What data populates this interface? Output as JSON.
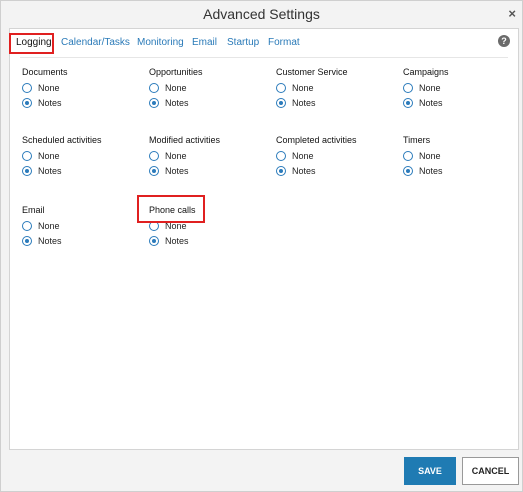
{
  "dialog": {
    "title": "Advanced Settings",
    "close_symbol": "×"
  },
  "tabs": [
    {
      "label": "Logging",
      "active": true
    },
    {
      "label": "Calendar/Tasks",
      "active": false
    },
    {
      "label": "Monitoring",
      "active": false
    },
    {
      "label": "Email",
      "active": false
    },
    {
      "label": "Startup",
      "active": false
    },
    {
      "label": "Format",
      "active": false
    }
  ],
  "help_symbol": "?",
  "groups": [
    {
      "label": "Documents",
      "options": [
        "None",
        "Notes"
      ],
      "selected": "Notes"
    },
    {
      "label": "Opportunities",
      "options": [
        "None",
        "Notes"
      ],
      "selected": "Notes"
    },
    {
      "label": "Customer Service",
      "options": [
        "None",
        "Notes"
      ],
      "selected": "Notes"
    },
    {
      "label": "Campaigns",
      "options": [
        "None",
        "Notes"
      ],
      "selected": "Notes"
    },
    {
      "label": "Scheduled activities",
      "options": [
        "None",
        "Notes"
      ],
      "selected": "Notes"
    },
    {
      "label": "Modified activities",
      "options": [
        "None",
        "Notes"
      ],
      "selected": "Notes"
    },
    {
      "label": "Completed activities",
      "options": [
        "None",
        "Notes"
      ],
      "selected": "Notes"
    },
    {
      "label": "Timers",
      "options": [
        "None",
        "Notes"
      ],
      "selected": "Notes"
    },
    {
      "label": "Email",
      "options": [
        "None",
        "Notes"
      ],
      "selected": "Notes"
    },
    {
      "label": "Phone calls",
      "options": [
        "None",
        "Notes"
      ],
      "selected": "Notes"
    }
  ],
  "footer": {
    "save_label": "SAVE",
    "cancel_label": "CANCEL"
  },
  "colors": {
    "accent": "#1f7bb3",
    "highlight": "#e02020"
  }
}
